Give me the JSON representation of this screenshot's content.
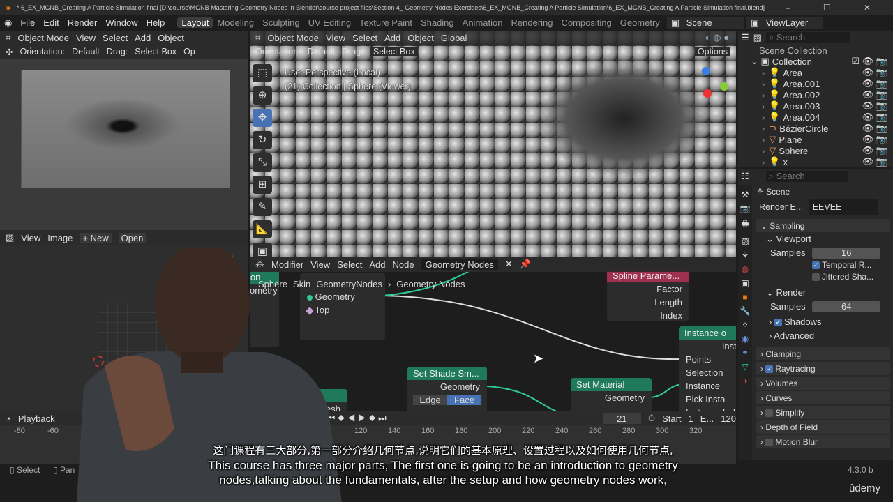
{
  "window": {
    "title": "* 6_EX_MGNB_Creating A Particle Simulation final [D:\\course\\MGNB Mastering Geometry Nodes in Blender\\course project files\\Section 4_ Geometry Nodes Exercises\\6_EX_MGNB_Creating A Particle Simulation\\6_EX_MGNB_Creating A Particle Simulation final.blend] - ",
    "controls": "–  ☐  ✕"
  },
  "menu": [
    "File",
    "Edit",
    "Render",
    "Window",
    "Help"
  ],
  "workspaces": [
    "Layout",
    "Modeling",
    "Sculpting",
    "UV Editing",
    "Texture Paint",
    "Shading",
    "Animation",
    "Rendering",
    "Compositing",
    "Geometry"
  ],
  "scene": "Scene",
  "view_layer": "ViewLayer",
  "left_viewport": {
    "mode": "Object Mode",
    "menus": [
      "View",
      "Select",
      "Add",
      "Object"
    ],
    "orientation_label": "Orientation:",
    "orientation": "Default",
    "drag_label": "Drag:",
    "drag": "Select Box",
    "options_short": "Op"
  },
  "main_viewport": {
    "mode": "Object Mode",
    "menus": [
      "View",
      "Select",
      "Add",
      "Object"
    ],
    "transform": "Global",
    "orientation_label": "Orientation:",
    "orientation": "Default",
    "drag_label": "Drag:",
    "drag": "Select Box",
    "options": "Options",
    "overlay_line1": "User Perspective (Local)",
    "overlay_line2": "(21) Collection | Sphere (Viewer)"
  },
  "image_editor": {
    "menus": [
      "View",
      "Image"
    ],
    "new": "+ New",
    "open": "Open"
  },
  "node_editor": {
    "type": "Modifier",
    "menus": [
      "View",
      "Select",
      "Add",
      "Node"
    ],
    "tree": "Geometry Nodes",
    "breadcrumb": [
      "Sphere",
      "Skin",
      "GeometryNodes",
      "Geometry Nodes"
    ],
    "nodes": {
      "sim": {
        "outputs": [
          "Geometry",
          "Top"
        ]
      },
      "spline": {
        "title": "Spline Parame...",
        "rows": [
          "Factor",
          "Length",
          "Index"
        ]
      },
      "instance": {
        "title": "Instance o",
        "rows": [
          "Insta",
          "Points",
          "Selection",
          "Instance",
          "Pick Insta",
          "Instance Ind"
        ]
      },
      "shade": {
        "title": "Set Shade Sm...",
        "rows": [
          "Geometry"
        ],
        "modes": [
          "Edge",
          "Face"
        ]
      },
      "material": {
        "title": "Set Material",
        "rows": [
          "Geometry"
        ]
      },
      "sphere": {
        "title": "here",
        "rows": [
          "Mesh"
        ]
      },
      "left": {
        "title": "ion",
        "rows": [
          "ometry"
        ]
      }
    }
  },
  "timeline": {
    "menu": "Playback",
    "frame": "21",
    "start_label": "Start",
    "start": "1",
    "end_label": "E...",
    "end": "120",
    "ticks": [
      "-80",
      "-60",
      "120",
      "140",
      "160",
      "180",
      "200",
      "220",
      "240",
      "260",
      "280",
      "300",
      "320"
    ]
  },
  "status": {
    "select": "Select",
    "pan": "Pan",
    "version": "4.3.0 b"
  },
  "outliner": {
    "search": "Search",
    "scene_collection": "Scene Collection",
    "collection": "Collection",
    "items": [
      {
        "name": "Area",
        "type": "light"
      },
      {
        "name": "Area.001",
        "type": "light"
      },
      {
        "name": "Area.002",
        "type": "light"
      },
      {
        "name": "Area.003",
        "type": "light"
      },
      {
        "name": "Area.004",
        "type": "light"
      },
      {
        "name": "BézierCircle",
        "type": "curve"
      },
      {
        "name": "Plane",
        "type": "mesh"
      },
      {
        "name": "Sphere",
        "type": "mesh"
      },
      {
        "name": "x",
        "type": "light"
      }
    ]
  },
  "properties": {
    "search": "Search",
    "scene": "Scene",
    "render_engine_label": "Render E...",
    "render_engine": "EEVEE",
    "sampling": "Sampling",
    "viewport": "Viewport",
    "samples_label": "Samples",
    "viewport_samples": "16",
    "temporal": "Temporal R...",
    "jittered": "Jittered Sha...",
    "render": "Render",
    "render_samples": "64",
    "shadows": "Shadows",
    "advanced": "Advanced",
    "panels": [
      "Clamping",
      "Raytracing",
      "Volumes",
      "Curves",
      "Simplify",
      "Depth of Field",
      "Motion Blur"
    ]
  },
  "subtitles": {
    "zh": "这门课程有三大部分,第一部分介绍几何节点,说明它们的基本原理、设置过程以及如何使用几何节点,",
    "en1": "This course has three major parts, The first one is going to be an introduction to geometry",
    "en2": "nodes,talking about the fundamentals, after the setup and how geometry nodes work,"
  },
  "watermark": "ûdemy",
  "colors": {
    "accent": "#4772b3",
    "node_geometry": "#1e7a5a",
    "node_input": "#a0304f",
    "socket_geometry": "#2ecc9a"
  }
}
